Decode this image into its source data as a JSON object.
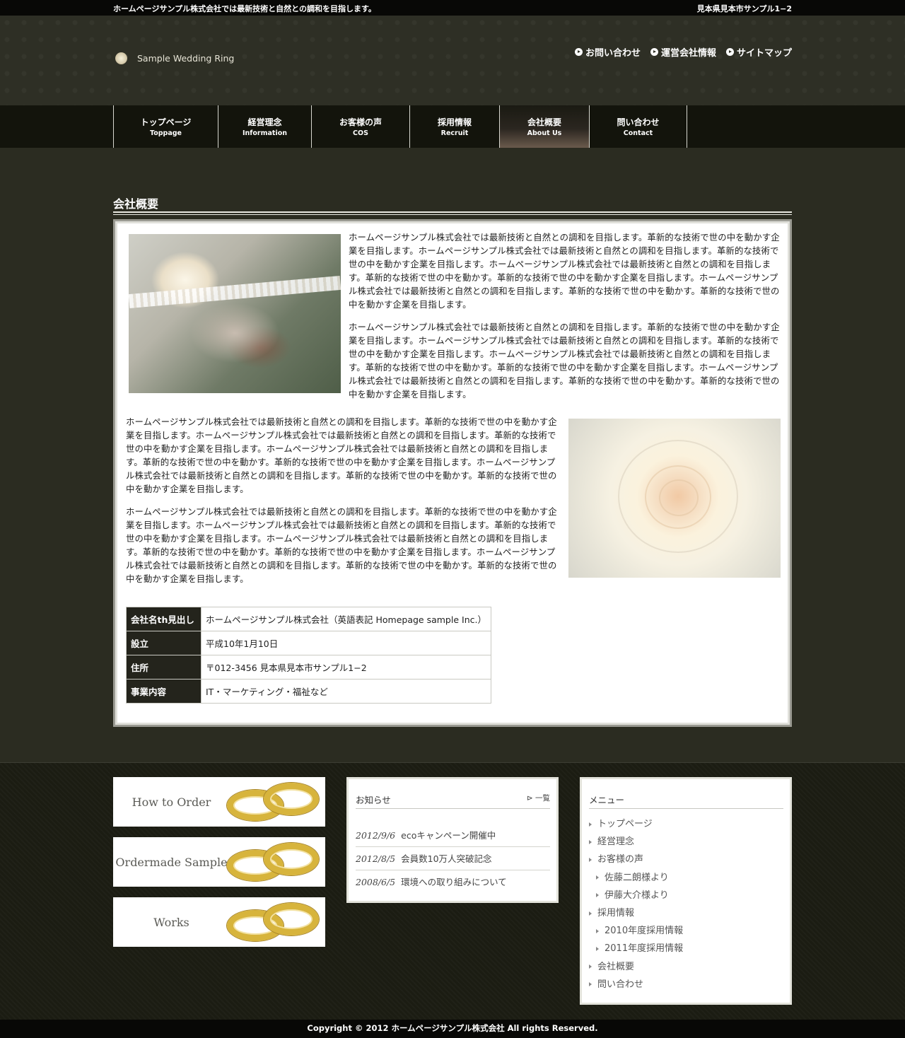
{
  "topbar": {
    "lead": "ホームページサンプル株式会社では最新技術と自然との調和を目指します。",
    "address": "見本県見本市サンプル1−2"
  },
  "header": {
    "logo_text": "Sample Wedding Ring",
    "utility_links": [
      "お問い合わせ",
      "運営会社情報",
      "サイトマップ"
    ]
  },
  "nav": [
    {
      "jp": "トップページ",
      "en": "Toppage"
    },
    {
      "jp": "経営理念",
      "en": "Information"
    },
    {
      "jp": "お客様の声",
      "en": "COS"
    },
    {
      "jp": "採用情報",
      "en": "Recruit"
    },
    {
      "jp": "会社概要",
      "en": "About Us"
    },
    {
      "jp": "問い合わせ",
      "en": "Contact"
    }
  ],
  "page": {
    "title": "会社概要",
    "paragraph": "ホームページサンプル株式会社では最新技術と自然との調和を目指します。革新的な技術で世の中を動かす企業を目指します。ホームページサンプル株式会社では最新技術と自然との調和を目指します。革新的な技術で世の中を動かす企業を目指します。ホームページサンプル株式会社では最新技術と自然との調和を目指します。革新的な技術で世の中を動かす。革新的な技術で世の中を動かす企業を目指します。ホームページサンプル株式会社では最新技術と自然との調和を目指します。革新的な技術で世の中を動かす。革新的な技術で世の中を動かす企業を目指します。"
  },
  "company_table": [
    {
      "th": "会社名th見出し",
      "td": "ホームページサンプル株式会社（英語表記 Homepage sample Inc.）"
    },
    {
      "th": "設立",
      "td": "平成10年1月10日"
    },
    {
      "th": "住所",
      "td": "〒012-3456 見本県見本市サンプル1−2"
    },
    {
      "th": "事業内容",
      "td": "IT・マーケティング・福祉など"
    }
  ],
  "banners": [
    "How to Order",
    "Ordermade Sample",
    "Works"
  ],
  "news": {
    "title": "お知らせ",
    "more": "一覧",
    "items": [
      {
        "date": "2012/9/6",
        "text": "ecoキャンペーン開催中"
      },
      {
        "date": "2012/8/5",
        "text": "会員数10万人突破記念"
      },
      {
        "date": "2008/6/5",
        "text": "環境への取り組みについて"
      }
    ]
  },
  "menu": {
    "title": "メニュー",
    "items": [
      {
        "label": "トップページ",
        "sub": false
      },
      {
        "label": "経営理念",
        "sub": false
      },
      {
        "label": "お客様の声",
        "sub": false
      },
      {
        "label": "佐藤二朗様より",
        "sub": true
      },
      {
        "label": "伊藤大介様より",
        "sub": true
      },
      {
        "label": "採用情報",
        "sub": false
      },
      {
        "label": "2010年度採用情報",
        "sub": true
      },
      {
        "label": "2011年度採用情報",
        "sub": true
      },
      {
        "label": "会社概要",
        "sub": false
      },
      {
        "label": "問い合わせ",
        "sub": false
      }
    ]
  },
  "footer": {
    "copyright": "Copyright © 2012 ホームページサンプル株式会社 All rights Reserved."
  }
}
